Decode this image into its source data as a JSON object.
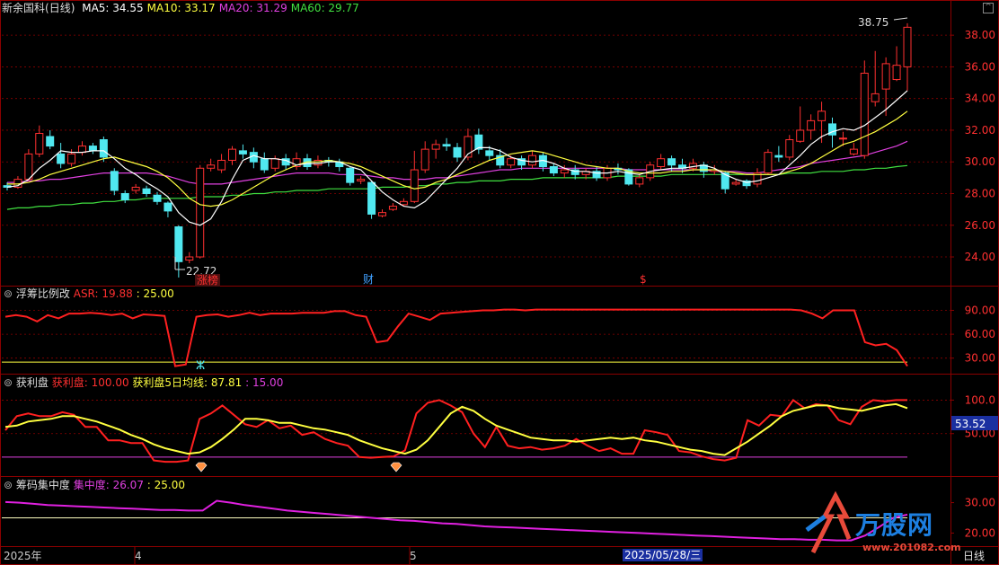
{
  "header": {
    "stock": "新余国科",
    "period": "(日线)",
    "ma": [
      {
        "label": "MA5: ",
        "value": "34.55",
        "color": "#ffffff"
      },
      {
        "label": "MA10: ",
        "value": "33.17",
        "color": "#ffff40"
      },
      {
        "label": "MA20: ",
        "value": "31.29",
        "color": "#e040e0"
      },
      {
        "label": "MA60: ",
        "value": "29.77",
        "color": "#40e040"
      }
    ]
  },
  "panels": {
    "asr": {
      "name": "浮筹比例改",
      "series_label": "ASR: ",
      "value": "19.88",
      "level": "25.00"
    },
    "profit": {
      "name": "获利盘",
      "s1_label": "获利盘: ",
      "s1_value": "100.00",
      "s2_label": "获利盘5日均线: ",
      "s2_value": "87.81",
      "level": "15.00",
      "marker": "53.52"
    },
    "conc": {
      "name": "筹码集中度",
      "series_label": "集中度: ",
      "value": "26.07",
      "level": "25.00"
    }
  },
  "annotations": {
    "high": "38.75",
    "low": "22.72",
    "tag1": "涨榜",
    "tag2": "财",
    "tag3": "$"
  },
  "xaxis": {
    "labels": [
      "2025年",
      "4",
      "5",
      "2025/05/28/三"
    ],
    "period_btn": "日线"
  },
  "watermark": {
    "text": "万股网",
    "url": "www.201082.com"
  },
  "colors": {
    "up": "#ff3030",
    "down": "#50e8f0",
    "bg": "#000000",
    "grid": "#8b0000"
  },
  "chart_data": [
    {
      "type": "candlestick",
      "title": "新余国科(日线)",
      "yticks": [
        "24.00",
        "26.00",
        "28.00",
        "30.00",
        "32.00",
        "34.00",
        "36.00",
        "38.00"
      ],
      "ylim": [
        22.3,
        39.2
      ],
      "candles": [
        [
          28.5,
          28.4,
          28.7,
          28.2
        ],
        [
          28.4,
          28.9,
          29.1,
          28.3
        ],
        [
          28.9,
          30.5,
          30.8,
          28.8
        ],
        [
          30.5,
          31.8,
          32.3,
          30.3
        ],
        [
          31.6,
          31.0,
          32.0,
          30.8
        ],
        [
          30.5,
          29.9,
          31.2,
          29.6
        ],
        [
          29.9,
          30.5,
          30.8,
          29.7
        ],
        [
          30.6,
          31.0,
          31.3,
          30.4
        ],
        [
          31.0,
          30.7,
          31.2,
          30.5
        ],
        [
          31.4,
          30.3,
          31.6,
          30.0
        ],
        [
          29.4,
          28.2,
          29.6,
          27.9
        ],
        [
          28.0,
          27.6,
          28.2,
          27.4
        ],
        [
          28.2,
          28.4,
          28.6,
          28.0
        ],
        [
          28.3,
          28.0,
          28.5,
          27.8
        ],
        [
          27.9,
          27.5,
          28.1,
          27.3
        ],
        [
          27.4,
          26.9,
          27.5,
          26.5
        ],
        [
          25.9,
          23.7,
          26.0,
          22.7
        ],
        [
          23.8,
          24.0,
          24.3,
          23.6
        ],
        [
          24.0,
          29.6,
          29.8,
          23.9
        ],
        [
          29.6,
          29.8,
          30.2,
          29.4
        ],
        [
          29.5,
          30.1,
          30.5,
          29.3
        ],
        [
          30.1,
          30.8,
          31.0,
          29.8
        ],
        [
          30.7,
          30.5,
          31.1,
          30.2
        ],
        [
          30.6,
          30.0,
          30.9,
          29.6
        ],
        [
          30.2,
          29.5,
          30.6,
          29.3
        ],
        [
          29.6,
          30.2,
          30.4,
          29.4
        ],
        [
          30.2,
          29.8,
          30.5,
          29.5
        ],
        [
          29.7,
          30.2,
          30.6,
          29.5
        ],
        [
          30.2,
          29.7,
          30.5,
          29.5
        ],
        [
          29.8,
          30.1,
          30.4,
          29.6
        ],
        [
          30.1,
          30.0,
          30.3,
          29.7
        ],
        [
          30.0,
          29.7,
          30.2,
          29.4
        ],
        [
          29.6,
          28.7,
          29.7,
          28.5
        ],
        [
          28.8,
          28.9,
          29.1,
          28.6
        ],
        [
          28.7,
          26.7,
          28.8,
          26.4
        ],
        [
          26.6,
          26.8,
          27.0,
          26.5
        ],
        [
          27.0,
          27.2,
          27.4,
          26.9
        ],
        [
          27.3,
          27.5,
          27.7,
          27.2
        ],
        [
          27.5,
          29.5,
          30.7,
          27.4
        ],
        [
          29.5,
          30.8,
          31.3,
          29.3
        ],
        [
          30.8,
          31.1,
          31.4,
          30.2
        ],
        [
          31.1,
          31.0,
          31.5,
          30.7
        ],
        [
          30.9,
          30.3,
          31.2,
          30.0
        ],
        [
          30.3,
          31.6,
          32.1,
          30.1
        ],
        [
          31.7,
          30.8,
          32.1,
          30.5
        ],
        [
          30.7,
          30.4,
          31.0,
          30.1
        ],
        [
          30.4,
          29.8,
          30.8,
          29.6
        ],
        [
          29.8,
          30.2,
          30.4,
          29.6
        ],
        [
          30.2,
          29.8,
          30.4,
          29.5
        ],
        [
          29.8,
          30.4,
          30.7,
          29.6
        ],
        [
          30.4,
          29.7,
          30.6,
          29.4
        ],
        [
          29.7,
          29.3,
          29.9,
          29.1
        ],
        [
          29.3,
          29.5,
          29.8,
          29.0
        ],
        [
          29.5,
          29.2,
          29.8,
          28.9
        ],
        [
          29.2,
          29.4,
          29.6,
          28.9
        ],
        [
          29.4,
          29.0,
          29.7,
          28.8
        ],
        [
          29.0,
          29.6,
          29.8,
          28.8
        ],
        [
          29.6,
          29.5,
          29.9,
          29.2
        ],
        [
          29.5,
          28.6,
          29.6,
          28.5
        ],
        [
          28.6,
          29.0,
          29.2,
          28.4
        ],
        [
          29.0,
          29.8,
          30.0,
          28.8
        ],
        [
          29.7,
          30.2,
          30.5,
          29.5
        ],
        [
          30.2,
          29.8,
          30.4,
          29.4
        ],
        [
          29.8,
          29.6,
          30.2,
          29.3
        ],
        [
          29.6,
          29.9,
          30.2,
          29.4
        ],
        [
          29.8,
          29.4,
          30.0,
          29.0
        ],
        [
          29.4,
          29.5,
          29.8,
          29.2
        ],
        [
          29.3,
          28.3,
          29.4,
          28.0
        ],
        [
          28.6,
          28.7,
          28.9,
          28.5
        ],
        [
          28.8,
          28.5,
          28.9,
          28.3
        ],
        [
          28.6,
          29.3,
          29.6,
          28.4
        ],
        [
          29.3,
          30.6,
          30.8,
          29.2
        ],
        [
          30.4,
          30.3,
          31.0,
          30.0
        ],
        [
          30.3,
          31.4,
          31.7,
          30.1
        ],
        [
          31.3,
          32.0,
          33.5,
          31.2
        ],
        [
          32.0,
          32.6,
          33.0,
          31.4
        ],
        [
          32.6,
          33.2,
          33.8,
          31.2
        ],
        [
          32.4,
          31.7,
          32.8,
          30.9
        ],
        [
          31.5,
          31.5,
          31.9,
          31.0
        ],
        [
          30.5,
          30.8,
          31.2,
          30.4
        ],
        [
          30.4,
          35.6,
          36.4,
          30.2
        ],
        [
          33.8,
          34.3,
          37.0,
          33.5
        ],
        [
          34.6,
          36.2,
          36.6,
          32.9
        ],
        [
          35.2,
          36.1,
          37.3,
          35.1
        ],
        [
          36.0,
          38.5,
          38.75,
          34.5
        ]
      ],
      "ma5": [
        28.4,
        28.5,
        28.9,
        29.6,
        30.1,
        30.7,
        30.6,
        30.6,
        30.7,
        30.7,
        30.2,
        29.6,
        29.2,
        28.7,
        28.3,
        27.8,
        26.8,
        26.2,
        26.0,
        26.4,
        27.5,
        28.9,
        30.1,
        30.4,
        30.2,
        30.2,
        30.1,
        29.8,
        29.9,
        29.9,
        30.0,
        30.0,
        29.7,
        29.5,
        28.8,
        28.1,
        27.6,
        27.2,
        27.1,
        27.5,
        28.2,
        28.9,
        29.6,
        30.5,
        30.9,
        30.9,
        30.7,
        30.3,
        30.1,
        30.0,
        30.1,
        29.9,
        29.6,
        29.4,
        29.4,
        29.3,
        29.3,
        29.4,
        29.3,
        29.2,
        29.4,
        29.5,
        29.6,
        29.6,
        29.7,
        29.8,
        29.6,
        29.2,
        28.9,
        28.7,
        28.8,
        29.0,
        29.2,
        29.8,
        30.4,
        31.1,
        31.6,
        31.9,
        32.1,
        32.0,
        32.3,
        32.8,
        33.3,
        33.9,
        34.5
      ],
      "ma10": [
        28.6,
        28.6,
        28.7,
        28.9,
        29.2,
        29.4,
        29.6,
        29.8,
        30.0,
        30.2,
        30.3,
        30.1,
        29.9,
        29.7,
        29.4,
        29.0,
        28.4,
        27.7,
        27.3,
        27.2,
        27.3,
        27.6,
        28.0,
        28.4,
        28.8,
        29.2,
        29.5,
        29.8,
        30.0,
        30.0,
        30.1,
        30.0,
        29.9,
        29.7,
        29.4,
        29.1,
        28.8,
        28.5,
        28.3,
        28.4,
        28.7,
        28.9,
        29.2,
        29.5,
        29.8,
        30.1,
        30.3,
        30.5,
        30.6,
        30.7,
        30.6,
        30.4,
        30.2,
        30.0,
        29.8,
        29.7,
        29.6,
        29.6,
        29.4,
        29.3,
        29.3,
        29.3,
        29.4,
        29.4,
        29.5,
        29.5,
        29.5,
        29.4,
        29.3,
        29.2,
        29.2,
        29.2,
        29.2,
        29.4,
        29.6,
        29.9,
        30.3,
        30.7,
        31.1,
        31.3,
        31.6,
        31.9,
        32.3,
        32.7,
        33.2
      ],
      "ma20": [
        28.7,
        28.7,
        28.8,
        28.8,
        28.9,
        28.9,
        29.0,
        29.1,
        29.2,
        29.3,
        29.3,
        29.3,
        29.3,
        29.3,
        29.2,
        29.1,
        28.9,
        28.7,
        28.6,
        28.6,
        28.6,
        28.7,
        28.8,
        28.9,
        29.0,
        29.1,
        29.2,
        29.3,
        29.3,
        29.3,
        29.3,
        29.2,
        29.2,
        29.2,
        29.1,
        29.0,
        29.0,
        28.9,
        28.9,
        28.9,
        29.0,
        29.0,
        29.1,
        29.2,
        29.3,
        29.4,
        29.5,
        29.5,
        29.6,
        29.6,
        29.6,
        29.6,
        29.6,
        29.6,
        29.6,
        29.6,
        29.6,
        29.6,
        29.5,
        29.5,
        29.5,
        29.5,
        29.5,
        29.5,
        29.5,
        29.5,
        29.4,
        29.4,
        29.4,
        29.3,
        29.3,
        29.4,
        29.5,
        29.6,
        29.7,
        29.9,
        30.0,
        30.1,
        30.2,
        30.3,
        30.4,
        30.6,
        30.8,
        31.0,
        31.3
      ],
      "ma60": [
        27.0,
        27.1,
        27.1,
        27.2,
        27.2,
        27.3,
        27.3,
        27.4,
        27.4,
        27.5,
        27.5,
        27.6,
        27.6,
        27.7,
        27.7,
        27.7,
        27.7,
        27.7,
        27.8,
        27.8,
        27.8,
        27.9,
        27.9,
        28.0,
        28.0,
        28.1,
        28.1,
        28.2,
        28.2,
        28.2,
        28.3,
        28.3,
        28.3,
        28.3,
        28.3,
        28.4,
        28.4,
        28.4,
        28.5,
        28.5,
        28.6,
        28.6,
        28.7,
        28.7,
        28.8,
        28.8,
        28.8,
        28.9,
        28.9,
        28.9,
        29.0,
        29.0,
        29.0,
        29.0,
        29.0,
        29.0,
        29.0,
        29.1,
        29.1,
        29.1,
        29.1,
        29.1,
        29.2,
        29.2,
        29.2,
        29.2,
        29.2,
        29.2,
        29.2,
        29.2,
        29.2,
        29.2,
        29.2,
        29.3,
        29.3,
        29.3,
        29.4,
        29.4,
        29.4,
        29.5,
        29.5,
        29.6,
        29.6,
        29.7,
        29.77
      ]
    },
    {
      "type": "line",
      "title": "浮筹比例改",
      "yticks": [
        "30.00",
        "60.00",
        "90.00"
      ],
      "ylim": [
        15,
        103
      ],
      "asr": [
        82,
        84,
        82,
        76,
        84,
        80,
        86,
        86,
        87,
        86,
        84,
        86,
        80,
        85,
        84,
        83,
        20,
        22,
        82,
        84,
        85,
        82,
        84,
        87,
        84,
        86,
        86,
        86,
        87,
        87,
        87,
        89,
        89,
        84,
        82,
        50,
        52,
        70,
        86,
        82,
        78,
        86,
        87,
        88,
        89,
        90,
        90,
        91,
        91,
        90,
        91,
        91,
        91,
        91,
        91,
        91,
        91,
        91,
        91,
        91,
        91,
        91,
        91,
        91,
        91,
        91,
        91,
        91,
        91,
        91,
        91,
        91,
        91,
        91,
        91,
        90,
        86,
        80,
        90,
        90,
        90,
        50,
        46,
        48,
        40,
        20
      ],
      "level": 25
    },
    {
      "type": "line",
      "title": "获利盘",
      "yticks": [
        "50.00",
        "100.0"
      ],
      "ylim": [
        -8,
        118
      ],
      "profit": [
        55,
        76,
        80,
        76,
        76,
        82,
        78,
        60,
        60,
        40,
        40,
        36,
        36,
        10,
        8,
        8,
        10,
        72,
        80,
        92,
        78,
        64,
        60,
        70,
        58,
        62,
        48,
        52,
        42,
        36,
        32,
        15,
        14,
        15,
        16,
        25,
        80,
        96,
        100,
        92,
        82,
        50,
        30,
        60,
        32,
        28,
        30,
        26,
        28,
        32,
        42,
        32,
        24,
        28,
        20,
        20,
        55,
        52,
        48,
        24,
        22,
        16,
        12,
        10,
        14,
        70,
        62,
        78,
        76,
        100,
        88,
        94,
        92,
        70,
        64,
        90,
        100,
        98,
        100,
        100
      ],
      "ma5": [
        60,
        62,
        68,
        70,
        72,
        76,
        76,
        72,
        68,
        62,
        56,
        48,
        42,
        34,
        28,
        24,
        20,
        22,
        30,
        42,
        56,
        72,
        72,
        70,
        66,
        66,
        62,
        58,
        56,
        52,
        48,
        40,
        34,
        28,
        24,
        20,
        26,
        40,
        60,
        80,
        90,
        84,
        72,
        62,
        56,
        50,
        44,
        42,
        40,
        40,
        38,
        40,
        42,
        44,
        42,
        44,
        40,
        38,
        34,
        30,
        26,
        24,
        20,
        18,
        28,
        38,
        50,
        62,
        76,
        84,
        88,
        92,
        92,
        88,
        86,
        84,
        88,
        92,
        94,
        88
      ],
      "level": 15
    },
    {
      "type": "line",
      "title": "筹码集中度",
      "yticks": [
        "20.00",
        "30.00"
      ],
      "ylim": [
        16,
        34
      ],
      "conc": [
        30.2,
        30.0,
        29.6,
        29.2,
        29.0,
        28.8,
        28.6,
        28.4,
        28.2,
        28.0,
        27.8,
        27.6,
        27.6,
        27.4,
        27.4,
        30.6,
        30.0,
        29.2,
        28.6,
        28.0,
        27.4,
        27.0,
        26.6,
        26.2,
        25.8,
        25.4,
        25.0,
        24.6,
        24.2,
        24.0,
        23.6,
        23.2,
        23.0,
        22.6,
        22.2,
        22.0,
        21.8,
        21.6,
        21.4,
        21.2,
        21.0,
        20.8,
        20.6,
        20.4,
        20.2,
        20.0,
        19.8,
        19.6,
        19.4,
        19.2,
        19.0,
        18.8,
        18.6,
        18.4,
        18.2,
        18.0,
        18.0,
        17.8,
        17.8,
        17.6,
        17.6,
        19.2,
        22.0,
        25.0,
        26.07
      ],
      "level": 25
    }
  ]
}
